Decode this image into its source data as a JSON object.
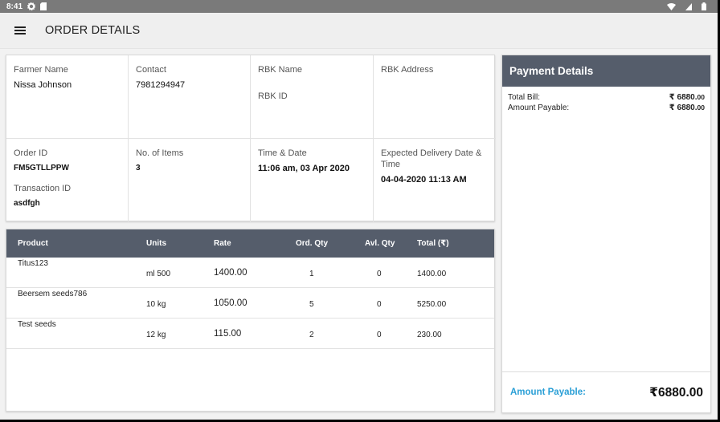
{
  "status_bar": {
    "time": "8:41"
  },
  "app_bar": {
    "title": "ORDER DETAILS"
  },
  "info": {
    "farmer_name_label": "Farmer Name",
    "farmer_name": "Nissa Johnson",
    "contact_label": "Contact",
    "contact": "7981294947",
    "rbk_name_label": "RBK Name",
    "rbk_id_label": "RBK ID",
    "rbk_address_label": "RBK Address",
    "order_id_label": "Order ID",
    "order_id": "FM5GTLLPPW",
    "transaction_id_label": "Transaction ID",
    "transaction_id": "asdfgh",
    "items_label": "No. of Items",
    "items": "3",
    "time_date_label": "Time & Date",
    "time_date": "11:06 am, 03 Apr 2020",
    "delivery_label": "Expected Delivery Date & Time",
    "delivery": "04-04-2020 11:13 AM"
  },
  "table": {
    "headers": [
      "Product",
      "Units",
      "Rate",
      "Ord. Qty",
      "Avl. Qty",
      "Total (₹)"
    ],
    "rows": [
      {
        "product": "Titus123",
        "units": "ml 500",
        "rate": "1400.00",
        "ord_qty": "1",
        "avl_qty": "0",
        "total": "1400.00"
      },
      {
        "product": "Beersem seeds786",
        "units": "10 kg",
        "rate": "1050.00",
        "ord_qty": "5",
        "avl_qty": "0",
        "total": "5250.00"
      },
      {
        "product": "Test seeds",
        "units": "12 kg",
        "rate": "115.00",
        "ord_qty": "2",
        "avl_qty": "0",
        "total": "230.00"
      }
    ]
  },
  "payment": {
    "title": "Payment Details",
    "total_bill_label": "Total Bill:",
    "total_bill_main": "₹ 6880.",
    "total_bill_dec": "00",
    "amount_payable_label": "Amount Payable:",
    "amount_payable_main": "₹ 6880.",
    "amount_payable_dec": "00",
    "footer_label": "Amount Payable:",
    "footer_amount": "₹6880.00"
  },
  "colors": {
    "header_bg": "#555d6b",
    "accent": "#2a9fd6"
  },
  "icons": [
    "settings-icon",
    "sim-icon",
    "wifi-icon",
    "battery-icon",
    "menu-icon"
  ]
}
